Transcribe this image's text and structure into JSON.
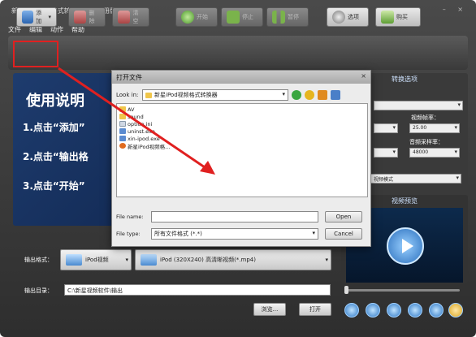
{
  "window": {
    "title": "新星iPod视频格式转换器（未注册版本）",
    "controls": "– ×"
  },
  "menu": [
    "文件",
    "编辑",
    "动作",
    "帮助"
  ],
  "toolbar": {
    "add": "添加",
    "delete": "删除",
    "clear": "清空",
    "start": "开始",
    "stop": "停止",
    "pause": "暂停",
    "options": "选项",
    "buy": "购买"
  },
  "guide": {
    "title": "使用说明",
    "step1": "1.点击“添加”",
    "step2": "2.点击“输出格",
    "step3": "3.点击“开始”"
  },
  "settings": {
    "header": "转换选项",
    "video_frame_label": "视频帧率：",
    "video_frame_value": "25.00",
    "audio_sample_label": "音频采样率：",
    "audio_sample_value": "48000",
    "mode_value": "视频模式"
  },
  "preview": {
    "header": "视频预览"
  },
  "output": {
    "format_label": "输出格式：",
    "format_device": "iPod视频",
    "format_profile": "iPod (320X240) 高清晰视频(*.mp4)",
    "dir_label": "输出目录：",
    "dir_value": "C:\\新星视频软件\\输出",
    "browse": "浏览...",
    "open": "打开"
  },
  "dialog": {
    "title": "打开文件",
    "look_in_label": "Look in:",
    "look_in_value": "新星iPod视频格式转换器",
    "files": [
      {
        "name": "AV",
        "type": "folder"
      },
      {
        "name": "sound",
        "type": "folder"
      },
      {
        "name": "option.ini",
        "type": "file"
      },
      {
        "name": "uninst.exe",
        "type": "exe"
      },
      {
        "name": "xin-ipod.exe",
        "type": "exe"
      },
      {
        "name": "新星iPod视频格...",
        "type": "app"
      }
    ],
    "filename_label": "File name:",
    "filename_value": "",
    "filetype_label": "File type:",
    "filetype_value": "所有文件格式 (*.*)",
    "open_btn": "Open",
    "cancel_btn": "Cancel"
  },
  "colors": {
    "annotation_red": "#e02020",
    "accent_blue": "#2d76c4"
  }
}
